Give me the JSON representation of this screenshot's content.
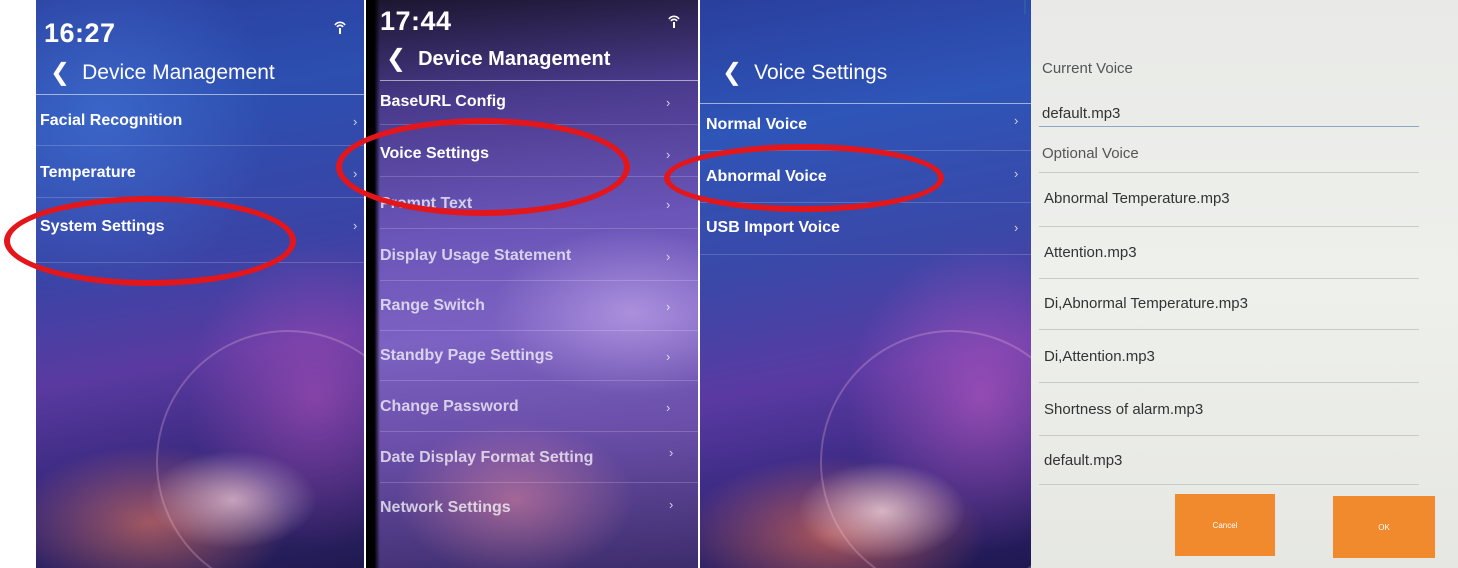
{
  "panel1": {
    "time": "16:27",
    "header": {
      "back_icon": "chevron-left-icon",
      "title": "Device Management"
    },
    "items": [
      {
        "label": "Facial Recognition"
      },
      {
        "label": "Temperature"
      },
      {
        "label": "System Settings"
      }
    ]
  },
  "panel2": {
    "time": "17:44",
    "header": {
      "back_icon": "chevron-left-icon",
      "title": "Device Management"
    },
    "items": [
      {
        "label": "BaseURL Config"
      },
      {
        "label": "Voice Settings"
      },
      {
        "label": "Prompt Text"
      },
      {
        "label": "Display Usage Statement"
      },
      {
        "label": "Range Switch"
      },
      {
        "label": "Standby Page Settings"
      },
      {
        "label": "Change Password"
      },
      {
        "label": "Date Display Format Setting"
      },
      {
        "label": "Network Settings"
      }
    ]
  },
  "panel3": {
    "header": {
      "back_icon": "chevron-left-icon",
      "title": "Voice Settings"
    },
    "items": [
      {
        "label": "Normal Voice"
      },
      {
        "label": "Abnormal Voice"
      },
      {
        "label": "USB Import Voice"
      }
    ]
  },
  "panel4": {
    "current_label": "Current Voice",
    "current_value": "default.mp3",
    "optional_label": "Optional Voice",
    "options": [
      "Abnormal Temperature.mp3",
      "Attention.mp3",
      "Di,Abnormal Temperature.mp3",
      "Di,Attention.mp3",
      "Shortness of alarm.mp3",
      "default.mp3"
    ],
    "cancel_label": "Cancel",
    "ok_label": "OK"
  },
  "highlights": {
    "color": "#e3161b",
    "circled": [
      "System Settings",
      "Voice Settings",
      "Abnormal Voice"
    ]
  },
  "colors": {
    "button": "#f08a2c"
  }
}
